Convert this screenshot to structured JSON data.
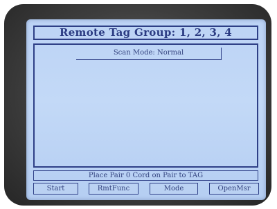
{
  "screen": {
    "title": "Remote Tag Group: 1, 2, 3, 4",
    "scan_mode": "Scan Mode: Normal",
    "message": "Place Pair 0 Cord on Pair to TAG"
  },
  "softkeys": [
    {
      "label": "Start"
    },
    {
      "label": "RmtFunc"
    },
    {
      "label": "Mode"
    },
    {
      "label": "OpenMsr"
    }
  ]
}
